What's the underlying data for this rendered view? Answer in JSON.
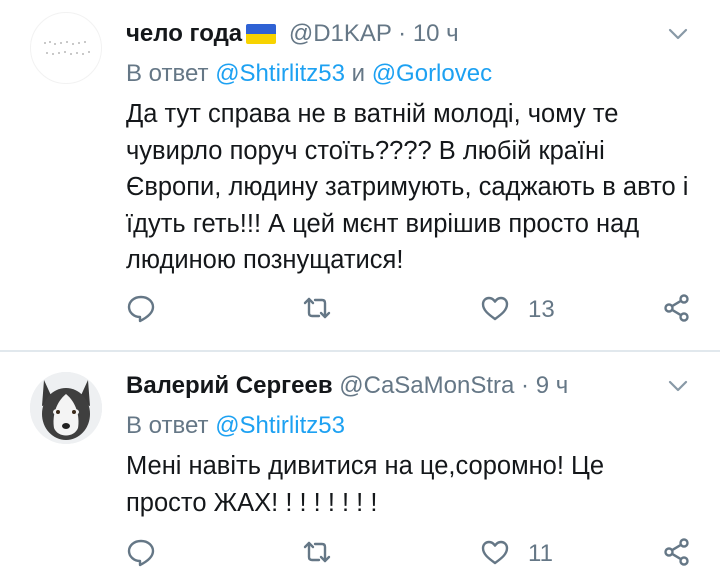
{
  "tweets": [
    {
      "author_name": "чело года",
      "handle": "@D1KAP",
      "separator": "·",
      "time": "10 ч",
      "reply_prefix": "В ответ",
      "reply_mentions": [
        "@Shtirlitz53",
        "@Gorlovec"
      ],
      "reply_joiner": "и",
      "text": "Да тут справа не в ватній молоді, чому те чувирло поруч стоїть???? В любій країні Європи, людину затримують, саджають в авто і їдуть геть!!! А цей мєнт вирішив просто над людиною познущатися!",
      "like_count": "13",
      "flag_colors": [
        "#2f62d4",
        "#f7d300"
      ],
      "icons": [
        "reply-icon",
        "retweet-icon",
        "like-icon",
        "share-icon",
        "chevron-down-icon"
      ]
    },
    {
      "author_name": "Валерий Сергеев",
      "handle": "@CaSaMonStra",
      "separator": "·",
      "time": "9 ч",
      "reply_prefix": "В ответ",
      "reply_mentions": [
        "@Shtirlitz53"
      ],
      "text": "Мені навіть дивитися на це,соромно! Це просто ЖАХ! ! ! ! ! ! ! !",
      "like_count": "11",
      "icons": [
        "reply-icon",
        "retweet-icon",
        "like-icon",
        "share-icon",
        "chevron-down-icon"
      ]
    }
  ],
  "colors": {
    "link": "#1da1f2",
    "secondary_text": "#657786",
    "divider": "#e1e8ed"
  }
}
